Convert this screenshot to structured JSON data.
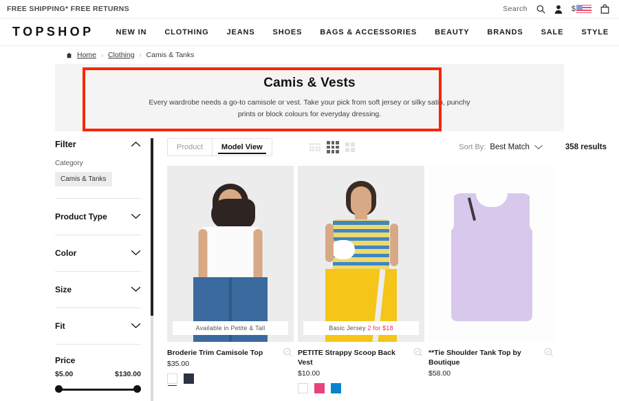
{
  "promo": {
    "text": "FREE SHIPPING* FREE RETURNS",
    "search_label": "Search",
    "currency_symbol": "$"
  },
  "nav": {
    "brand": "TOPSHOP",
    "items": [
      {
        "label": "NEW IN"
      },
      {
        "label": "CLOTHING"
      },
      {
        "label": "JEANS"
      },
      {
        "label": "SHOES"
      },
      {
        "label": "BAGS & ACCESSORIES"
      },
      {
        "label": "BEAUTY"
      },
      {
        "label": "BRANDS"
      },
      {
        "label": "SALE"
      },
      {
        "label": "STYLE"
      }
    ]
  },
  "breadcrumb": {
    "home": "Home",
    "sep": "›",
    "parent": "Clothing",
    "current": "Camis & Tanks"
  },
  "hero": {
    "title": "Camis & Vests",
    "subtitle": "Every wardrobe needs a go-to camisole or vest. Take your pick from soft jersey or silky satin, punchy prints or block colours for everyday dressing.",
    "highlight_color": "#fb2400"
  },
  "sidebar": {
    "filter_title": "Filter",
    "category_label": "Category",
    "category_chip": "Camis & Tanks",
    "facets": [
      {
        "label": "Product Type"
      },
      {
        "label": "Color"
      },
      {
        "label": "Size"
      },
      {
        "label": "Fit"
      }
    ],
    "price": {
      "title": "Price",
      "min": "$5.00",
      "max": "$130.00"
    }
  },
  "toolbar": {
    "tabs": [
      {
        "label": "Product",
        "active": false
      },
      {
        "label": "Model View",
        "active": true
      }
    ],
    "density": [
      {
        "name": "grid-4-column",
        "active": false
      },
      {
        "name": "grid-3-column",
        "active": true
      },
      {
        "name": "grid-2-column",
        "active": false
      }
    ],
    "sort_label": "Sort By:",
    "sort_value": "Best Match",
    "results_count": "358 results"
  },
  "products": [
    {
      "title": "Broderie Trim Camisole Top",
      "price": "$35.00",
      "badge": "Available in Petite & Tall",
      "badge_accent": "",
      "swatches": [
        {
          "name": "white",
          "color": "#ffffff",
          "selected": true
        },
        {
          "name": "navy",
          "color": "#2c3144",
          "selected": false
        }
      ]
    },
    {
      "title": "PETITE Strappy Scoop Back Vest",
      "price": "$10.00",
      "badge": "Basic Jersey ",
      "badge_accent": "2 for $18",
      "swatches": [
        {
          "name": "white",
          "color": "#ffffff",
          "selected": false
        },
        {
          "name": "pink",
          "color": "#e8437e",
          "selected": false
        },
        {
          "name": "blue",
          "color": "#0b82d0",
          "selected": false
        }
      ]
    },
    {
      "title": "**Tie Shoulder Tank Top by Boutique",
      "price": "$58.00",
      "badge": "",
      "badge_accent": "",
      "swatches": []
    }
  ]
}
